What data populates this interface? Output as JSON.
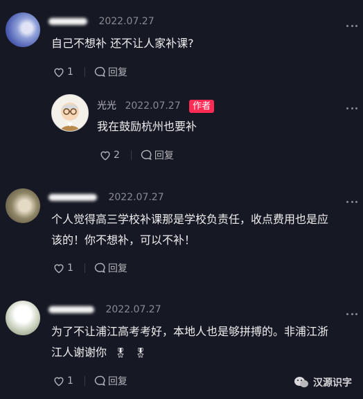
{
  "comments": [
    {
      "date": "2022.07.27",
      "text": "自己不想补 还不让人家补课?",
      "likes": "1",
      "reply_label": "回复",
      "reply": {
        "username": "光光",
        "date": "2022.07.27",
        "badge": "作者",
        "text": "我在鼓励杭州也要补",
        "likes": "2",
        "reply_label": "回复"
      }
    },
    {
      "date": "2022.07.27",
      "text_line1": "个人觉得高三学校补课那是学校负责任，收点费用也是应",
      "text_line2": "该的！你不想补，可以不补！",
      "likes": "1",
      "reply_label": "回复"
    },
    {
      "date": "2022.07.27",
      "text_line1": "为了不让浦江高考考好，本地人也是够拼搏的。非浦江浙",
      "text_line2": "江人谢谢你",
      "emoji": "🎖",
      "likes": "1",
      "reply_label": "回复"
    }
  ],
  "watermark": "汉源识字",
  "colors": {
    "background": "#161823",
    "author_badge": "#fe2c55",
    "muted": "#8a8b91"
  }
}
